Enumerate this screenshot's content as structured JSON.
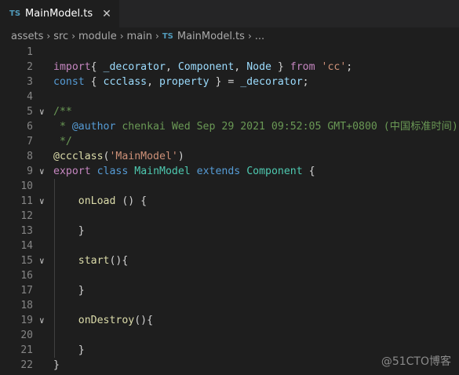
{
  "tab": {
    "badge": "TS",
    "title": "MainModel.ts",
    "close": "✕"
  },
  "breadcrumb": {
    "items": [
      "assets",
      "src",
      "module",
      "main"
    ],
    "file_badge": "TS",
    "file": "MainModel.ts",
    "more": "..."
  },
  "lines": [
    {
      "n": "1",
      "t": []
    },
    {
      "n": "2",
      "t": [
        [
          "kw2",
          "import"
        ],
        [
          "",
          "{ "
        ],
        [
          "var",
          "_decorator"
        ],
        [
          "",
          ", "
        ],
        [
          "var",
          "Component"
        ],
        [
          "",
          ", "
        ],
        [
          "var",
          "Node"
        ],
        [
          "",
          " } "
        ],
        [
          "kw2",
          "from"
        ],
        [
          "",
          " "
        ],
        [
          "str",
          "'cc'"
        ],
        [
          "",
          ";"
        ]
      ]
    },
    {
      "n": "3",
      "t": [
        [
          "kw",
          "const"
        ],
        [
          "",
          " { "
        ],
        [
          "var",
          "ccclass"
        ],
        [
          "",
          ", "
        ],
        [
          "var",
          "property"
        ],
        [
          "",
          " } = "
        ],
        [
          "var",
          "_decorator"
        ],
        [
          "",
          ";"
        ]
      ]
    },
    {
      "n": "4",
      "t": []
    },
    {
      "n": "5",
      "fold": "∨",
      "t": [
        [
          "cmt",
          "/**"
        ]
      ]
    },
    {
      "n": "6",
      "t": [
        [
          "cmt",
          " * "
        ],
        [
          "cmtag",
          "@author"
        ],
        [
          "cmt",
          " chenkai Wed Sep 29 2021 09:52:05 GMT+0800 (中国标准时间)"
        ]
      ]
    },
    {
      "n": "7",
      "t": [
        [
          "cmt",
          " */"
        ]
      ]
    },
    {
      "n": "8",
      "t": [
        [
          "fn",
          "@ccclass"
        ],
        [
          "",
          "("
        ],
        [
          "str",
          "'MainModel'"
        ],
        [
          "",
          ")"
        ]
      ]
    },
    {
      "n": "9",
      "fold": "∨",
      "t": [
        [
          "kw2",
          "export"
        ],
        [
          "",
          " "
        ],
        [
          "kw",
          "class"
        ],
        [
          "",
          " "
        ],
        [
          "cls",
          "MainModel"
        ],
        [
          "",
          " "
        ],
        [
          "kw",
          "extends"
        ],
        [
          "",
          " "
        ],
        [
          "cls",
          "Component"
        ],
        [
          "",
          " {"
        ]
      ]
    },
    {
      "n": "10",
      "t": []
    },
    {
      "n": "11",
      "fold": "∨",
      "t": [
        [
          "",
          "    "
        ],
        [
          "fn",
          "onLoad"
        ],
        [
          "",
          " () {"
        ]
      ]
    },
    {
      "n": "12",
      "t": []
    },
    {
      "n": "13",
      "t": [
        [
          "",
          "    }"
        ]
      ]
    },
    {
      "n": "14",
      "t": []
    },
    {
      "n": "15",
      "fold": "∨",
      "t": [
        [
          "",
          "    "
        ],
        [
          "fn",
          "start"
        ],
        [
          "",
          "(){"
        ]
      ]
    },
    {
      "n": "16",
      "t": []
    },
    {
      "n": "17",
      "t": [
        [
          "",
          "    }"
        ]
      ]
    },
    {
      "n": "18",
      "t": []
    },
    {
      "n": "19",
      "fold": "∨",
      "t": [
        [
          "",
          "    "
        ],
        [
          "fn",
          "onDestroy"
        ],
        [
          "",
          "(){"
        ]
      ]
    },
    {
      "n": "20",
      "t": []
    },
    {
      "n": "21",
      "t": [
        [
          "",
          "    }"
        ]
      ]
    },
    {
      "n": "22",
      "t": [
        [
          "",
          "}"
        ]
      ]
    }
  ],
  "watermark": "@51CTO博客"
}
